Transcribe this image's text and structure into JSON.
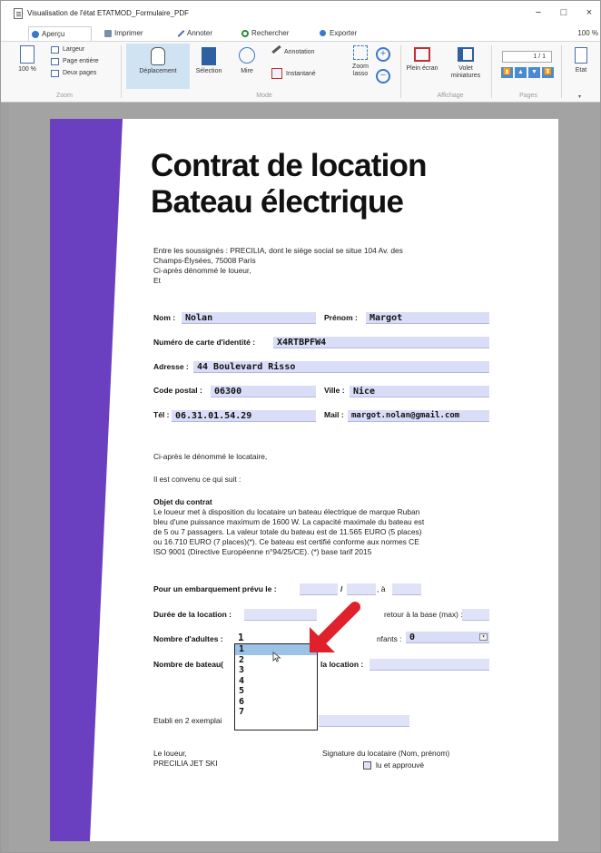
{
  "window": {
    "title": "Visualisation de l'état ETATMOD_Formulaire_PDF",
    "controls": [
      "−",
      "□",
      "×"
    ]
  },
  "tabs": [
    {
      "label": "Aperçu"
    },
    {
      "label": "Imprimer"
    },
    {
      "label": "Annoter"
    },
    {
      "label": "Rechercher"
    },
    {
      "label": "Exporter"
    }
  ],
  "tab_right_text": "100 %",
  "ribbon": {
    "zoom_label": "100 %",
    "zoom_items": [
      "Largeur",
      "Page entière",
      "Deux pages"
    ],
    "mode_buttons": {
      "deplacement": "Déplacement",
      "selection": "Sélection",
      "mire": "Mire",
      "annotation": "Annotation",
      "instantane": "Instantané",
      "zoom_lasso": "Zoom lasso"
    },
    "affichage_buttons": {
      "plein_ecran": "Plein écran",
      "volet_miniatures": "Volet miniatures"
    },
    "page_indicator": "1 / 1",
    "etat": "Etat",
    "group_labels": {
      "zoom": "Zoom",
      "mode": "Mode",
      "affichage": "Affichage",
      "pages": "Pages"
    }
  },
  "document": {
    "title_line1": "Contrat de location",
    "title_line2": "Bateau électrique",
    "intro": [
      "Entre les soussignés : PRECILIA, dont le siège social se situe 104 Av. des",
      "Champs-Élysées, 75008 Paris",
      "Ci-après dénommé le loueur,",
      "Et"
    ],
    "fields": {
      "nom_label": "Nom :",
      "nom": "Nolan",
      "prenom_label": "Prénom :",
      "prenom": "Margot",
      "carte_label": "Numéro de carte d'identité :",
      "carte": "X4RTBPFW4",
      "adresse_label": "Adresse :",
      "adresse": "44 Boulevard Risso",
      "cp_label": "Code postal :",
      "cp": "06300",
      "ville_label": "Ville :",
      "ville": "Nice",
      "tel_label": "Tél :",
      "tel": "06.31.01.54.29",
      "mail_label": "Mail :",
      "mail": "margot.nolan@gmail.com"
    },
    "locataire_text": "Ci-après le dénommé le locataire,",
    "convenu_text": "Il est convenu ce qui suit :",
    "objet_title": "Objet du contrat",
    "objet_lines": [
      "Le loueur met à disposition du locataire un bateau électrique de marque Ruban",
      "bleu d'une puissance maximum de 1600 W. La capacité maximale du bateau est",
      "de 5 ou 7 passagers.  La valeur totale du bateau est de 11.565 EURO (5 places)",
      "ou  16.710 EURO (7 places)(*). Ce bateau est certifié conforme aux normes CE",
      "ISO 9001 (Directive Européenne n°94/25/CE). (*) base tarif 2015"
    ],
    "embarquement_label": "Pour un embarquement prévu le :",
    "embarquement_slash": "/",
    "embarquement_a": ", à",
    "duree_label": "Durée de la location :",
    "retour_label": "retour à la base (max) :",
    "adultes_label": "Nombre d'adultes :",
    "adultes_value": "1",
    "enfants_label": "nfants :",
    "enfants_value": "0",
    "bateau_label": "Nombre de bateau(",
    "location_label": "la location :",
    "etabli_label": "Etabli en 2 exemplai",
    "loueur_lines": [
      "Le loueur,",
      "PRECILIA JET SKI"
    ],
    "signature_label": "Signature du locataire (Nom, prénom)",
    "lu_approuve": "lu et approuvé",
    "dropdown_options": [
      "1",
      "2",
      "3",
      "4",
      "5",
      "6",
      "7"
    ]
  },
  "colors": {
    "stripe": "#6a3fc0",
    "field_bg": "#d9ddf7",
    "arrow": "#e0202a",
    "selected_option": "#9cc3e6"
  }
}
